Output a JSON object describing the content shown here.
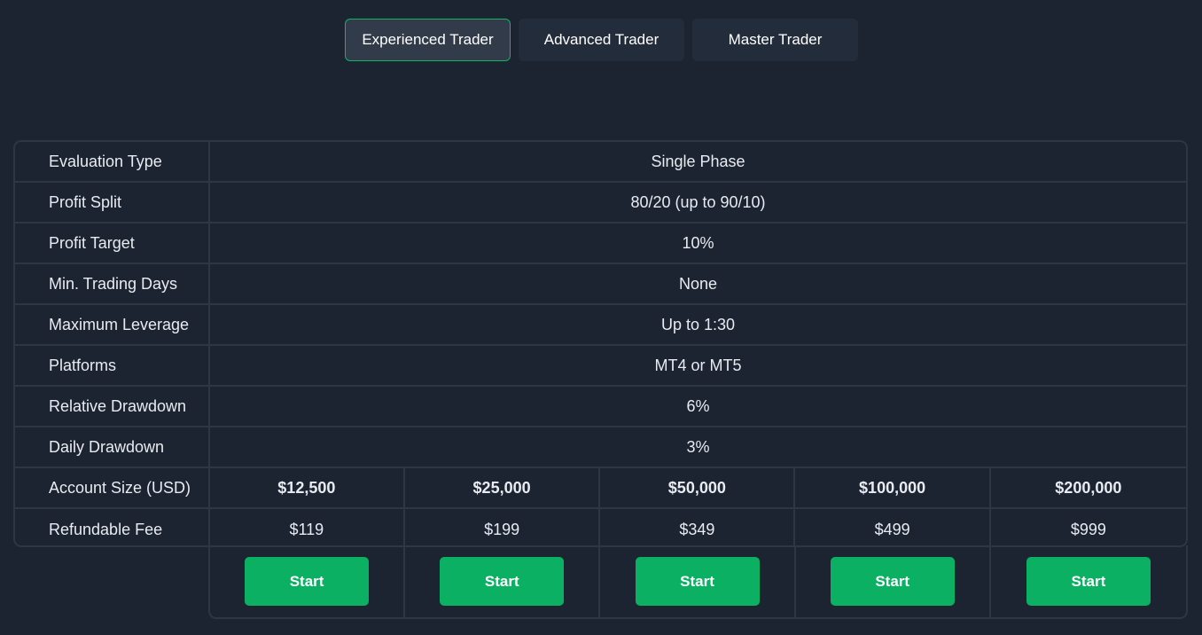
{
  "tabs": [
    {
      "label": "Experienced Trader",
      "active": true
    },
    {
      "label": "Advanced Trader",
      "active": false
    },
    {
      "label": "Master Trader",
      "active": false
    }
  ],
  "rows": [
    {
      "label": "Evaluation Type",
      "value": "Single Phase"
    },
    {
      "label": "Profit Split",
      "value": "80/20 (up to 90/10)"
    },
    {
      "label": "Profit Target",
      "value": "10%"
    },
    {
      "label": "Min. Trading Days",
      "value": "None"
    },
    {
      "label": "Maximum Leverage",
      "value": "Up to 1:30"
    },
    {
      "label": "Platforms",
      "value": "MT4 or MT5"
    },
    {
      "label": "Relative Drawdown",
      "value": "6%"
    },
    {
      "label": "Daily Drawdown",
      "value": "3%"
    }
  ],
  "account_size": {
    "label": "Account Size (USD)",
    "values": [
      "$12,500",
      "$25,000",
      "$50,000",
      "$100,000",
      "$200,000"
    ]
  },
  "refundable_fee": {
    "label": "Refundable Fee",
    "values": [
      "$119",
      "$199",
      "$349",
      "$499",
      "$999"
    ]
  },
  "start_button_label": "Start",
  "colors": {
    "background": "#1c2331",
    "accent_green": "#0bb062",
    "border": "#2c3645",
    "tab_bg": "#232c3b",
    "tab_active_bg": "#313b49"
  }
}
